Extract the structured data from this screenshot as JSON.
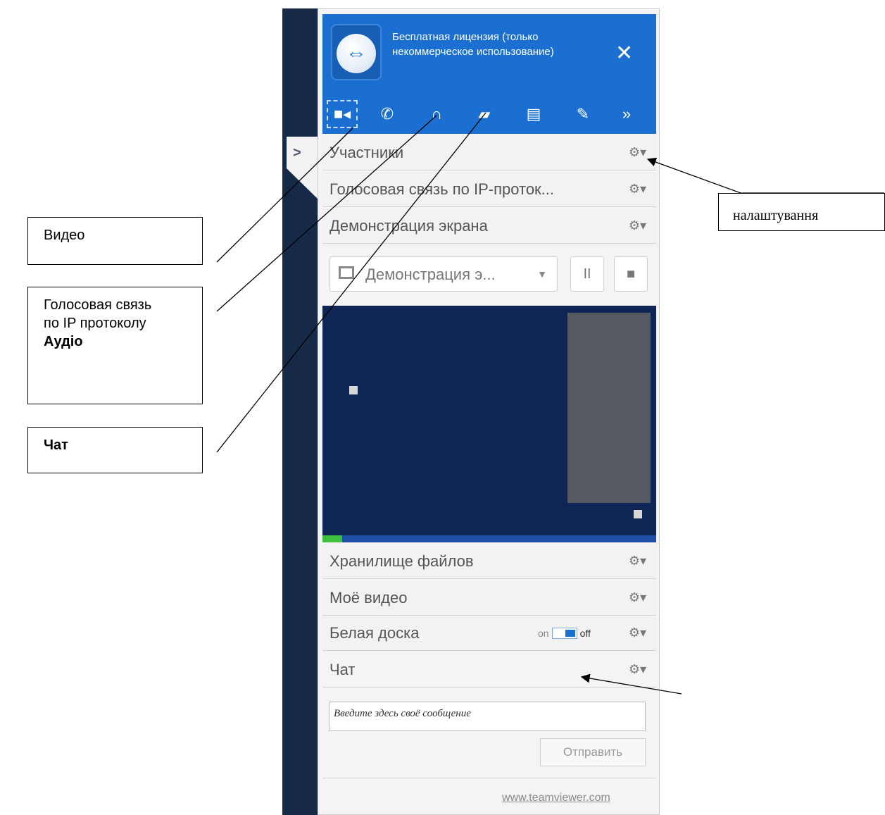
{
  "header": {
    "title": "Бесплатная лицензия (только некоммерческое использование)",
    "close_label": "✕"
  },
  "toolbar": {
    "items": [
      {
        "name": "video-icon",
        "glyph": "■◂"
      },
      {
        "name": "voip-icon",
        "glyph": "✆"
      },
      {
        "name": "headset-icon",
        "glyph": "∩"
      },
      {
        "name": "chat-icon",
        "glyph": "▰"
      },
      {
        "name": "file-icon",
        "glyph": "▤"
      },
      {
        "name": "whiteboard-icon",
        "glyph": "✎"
      },
      {
        "name": "more-icon",
        "glyph": "»"
      }
    ]
  },
  "sections": {
    "participants": "Участники",
    "voip": "Голосовая связь по IP-проток...",
    "screen_share": "Демонстрация экрана",
    "file_storage": "Хранилище файлов",
    "my_video": "Моё видео",
    "whiteboard": "Белая доска",
    "chat": "Чат"
  },
  "share_control": {
    "dropdown_label": "Демонстрация э...",
    "pause_glyph": "II",
    "stop_glyph": "■"
  },
  "whiteboard_toggle": {
    "on": "on",
    "off": "off"
  },
  "chat_box": {
    "placeholder": "Введите здесь своё сообщение",
    "send_label": "Отправить"
  },
  "footer": {
    "link": "www.teamviewer.com"
  },
  "icons": {
    "gear": "⚙▾",
    "collapse": ">"
  },
  "callouts": {
    "video": "Видео",
    "voip_line1": "Голосовая связь",
    "voip_line2": "по IP протоколу",
    "voip_line3": "Аудіо",
    "chat": "Чат",
    "settings": "налаштування"
  },
  "colors": {
    "accent": "#1a6fd0",
    "dark": "#162a48"
  }
}
